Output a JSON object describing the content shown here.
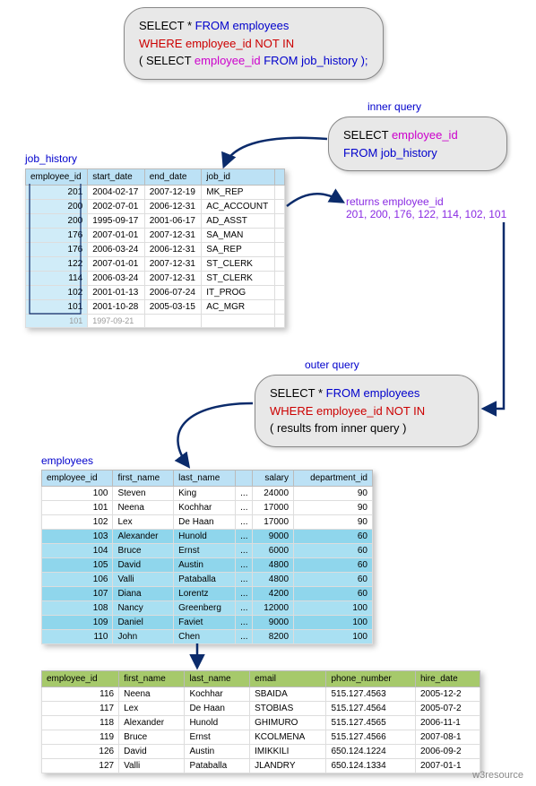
{
  "main_query": {
    "line1_a": "SELECT * ",
    "line1_b": "FROM employees",
    "line2_a": "WHERE employee_id NOT IN",
    "line3_a": "( SELECT ",
    "line3_b": "employee_id",
    "line3_c": " FROM job_history );"
  },
  "inner_label": "inner query",
  "inner_query": {
    "line1_a": "SELECT ",
    "line1_b": "employee_id",
    "line2_a": "FROM job_history"
  },
  "returns_label_a": "returns employee_id",
  "returns_label_b": "201, 200, 176, 122, 114, 102, 101",
  "job_history_label": "job_history",
  "job_history": {
    "headers": [
      "employee_id",
      "start_date",
      "end_date",
      "job_id",
      " "
    ],
    "rows": [
      [
        "201",
        "2004-02-17",
        "2007-12-19",
        "MK_REP"
      ],
      [
        "200",
        "2002-07-01",
        "2006-12-31",
        "AC_ACCOUNT"
      ],
      [
        "200",
        "1995-09-17",
        "2001-06-17",
        "AD_ASST"
      ],
      [
        "176",
        "2007-01-01",
        "2007-12-31",
        "SA_MAN"
      ],
      [
        "176",
        "2006-03-24",
        "2006-12-31",
        "SA_REP"
      ],
      [
        "122",
        "2007-01-01",
        "2007-12-31",
        "ST_CLERK"
      ],
      [
        "114",
        "2006-03-24",
        "2007-12-31",
        "ST_CLERK"
      ],
      [
        "102",
        "2001-01-13",
        "2006-07-24",
        "IT_PROG"
      ],
      [
        "101",
        "2001-10-28",
        "2005-03-15",
        "AC_MGR"
      ]
    ],
    "trunc": [
      "101",
      "1997-09-21",
      "",
      "",
      ""
    ]
  },
  "outer_label": "outer query",
  "outer_query": {
    "line1_a": "SELECT * ",
    "line1_b": "FROM employees",
    "line2_a": "WHERE employee_id NOT IN",
    "line3_a": "( results from inner query )"
  },
  "employees_label": "employees",
  "employees": {
    "headers": [
      "employee_id",
      "first_name",
      "last_name",
      "",
      "salary",
      "department_id"
    ],
    "rows": [
      {
        "hl": 0,
        "c": [
          "100",
          "Steven",
          "King",
          "...",
          "24000",
          "90"
        ]
      },
      {
        "hl": 0,
        "c": [
          "101",
          "Neena",
          "Kochhar",
          "...",
          "17000",
          "90"
        ]
      },
      {
        "hl": 0,
        "c": [
          "102",
          "Lex",
          "De Haan",
          "...",
          "17000",
          "90"
        ]
      },
      {
        "hl": 1,
        "c": [
          "103",
          "Alexander",
          "Hunold",
          "...",
          "9000",
          "60"
        ]
      },
      {
        "hl": 1,
        "c": [
          "104",
          "Bruce",
          "Ernst",
          "...",
          "6000",
          "60"
        ]
      },
      {
        "hl": 1,
        "c": [
          "105",
          "David",
          "Austin",
          "...",
          "4800",
          "60"
        ]
      },
      {
        "hl": 1,
        "c": [
          "106",
          "Valli",
          "Pataballa",
          "...",
          "4800",
          "60"
        ]
      },
      {
        "hl": 1,
        "c": [
          "107",
          "Diana",
          "Lorentz",
          "...",
          "4200",
          "60"
        ]
      },
      {
        "hl": 1,
        "c": [
          "108",
          "Nancy",
          "Greenberg",
          "...",
          "12000",
          "100"
        ]
      },
      {
        "hl": 1,
        "c": [
          "109",
          "Daniel",
          "Faviet",
          "...",
          "9000",
          "100"
        ]
      },
      {
        "hl": 1,
        "c": [
          "110",
          "John",
          "Chen",
          "...",
          "8200",
          "100"
        ]
      }
    ]
  },
  "result": {
    "headers": [
      "employee_id",
      "first_name",
      "last_name",
      "email",
      "phone_number",
      "hire_date"
    ],
    "rows": [
      [
        "116",
        "Neena",
        "Kochhar",
        "SBAIDA",
        "515.127.4563",
        "2005-12-2"
      ],
      [
        "117",
        "Lex",
        "De Haan",
        "STOBIAS",
        "515.127.4564",
        "2005-07-2"
      ],
      [
        "118",
        "Alexander",
        "Hunold",
        "GHIMURO",
        "515.127.4565",
        "2006-11-1"
      ],
      [
        "119",
        "Bruce",
        "Ernst",
        "KCOLMENA",
        "515.127.4566",
        "2007-08-1"
      ],
      [
        "126",
        "David",
        "Austin",
        "IMIKKILI",
        "650.124.1224",
        "2006-09-2"
      ],
      [
        "127",
        "Valli",
        "Pataballa",
        "JLANDRY",
        "650.124.1334",
        "2007-01-1"
      ]
    ]
  },
  "footer": "w3resource"
}
